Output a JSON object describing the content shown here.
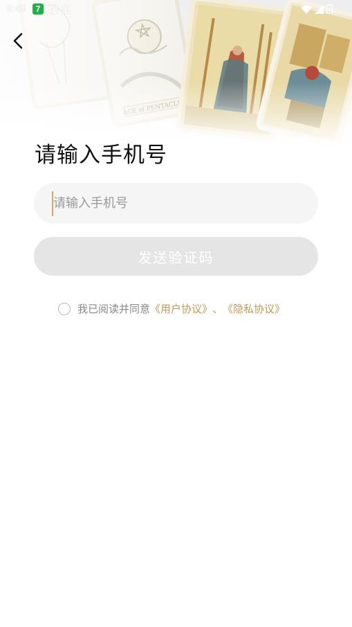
{
  "status_bar": {
    "time": "3:49",
    "app_badge": "7",
    "app_name": "爆虫"
  },
  "header": {
    "back_icon": "chevron-left-icon"
  },
  "main": {
    "title": "请输入手机号",
    "phone_input": {
      "placeholder": "请输入手机号",
      "value": ""
    },
    "send_button_label": "发送验证码",
    "agreement": {
      "checked": false,
      "prefix": "我已阅读并同意",
      "user_agreement": "《用户协议》",
      "separator": "、",
      "privacy_policy": "《隐私协议》"
    }
  },
  "colors": {
    "accent_link": "#c29a5a",
    "caret": "#e8a25a",
    "button_disabled": "#e5e5e5",
    "input_bg": "#f5f5f5"
  }
}
